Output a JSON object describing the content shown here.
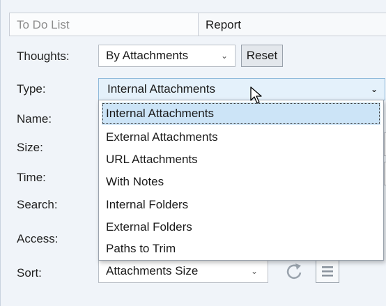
{
  "tabs": [
    {
      "label": "To Do List",
      "active": false
    },
    {
      "label": "Report",
      "active": true
    }
  ],
  "fields": {
    "thoughts": {
      "label": "Thoughts:",
      "value": "By Attachments"
    },
    "reset_label": "Reset",
    "type": {
      "label": "Type:",
      "value": "Internal Attachments"
    },
    "name_label": "Name:",
    "size_label": "Size:",
    "time_label": "Time:",
    "search_label": "Search:",
    "access_label": "Access:",
    "sort": {
      "label": "Sort:",
      "value": "Attachments Size"
    }
  },
  "type_options": [
    "Internal Attachments",
    "External Attachments",
    "URL Attachments",
    "With Notes",
    "Internal Folders",
    "External Folders",
    "Paths to Trim"
  ],
  "selected_type_index": 0,
  "icons": {
    "chevron": "chevron-down-icon",
    "refresh": "refresh-icon",
    "menu": "menu-icon",
    "cursor": "mouse-cursor-icon"
  },
  "colors": {
    "panel_bg": "#f0f4f9",
    "selected_option_bg": "#cce4f7",
    "open_select_bg": "#e4f1fb",
    "icon_gray": "#9aa3ad"
  }
}
